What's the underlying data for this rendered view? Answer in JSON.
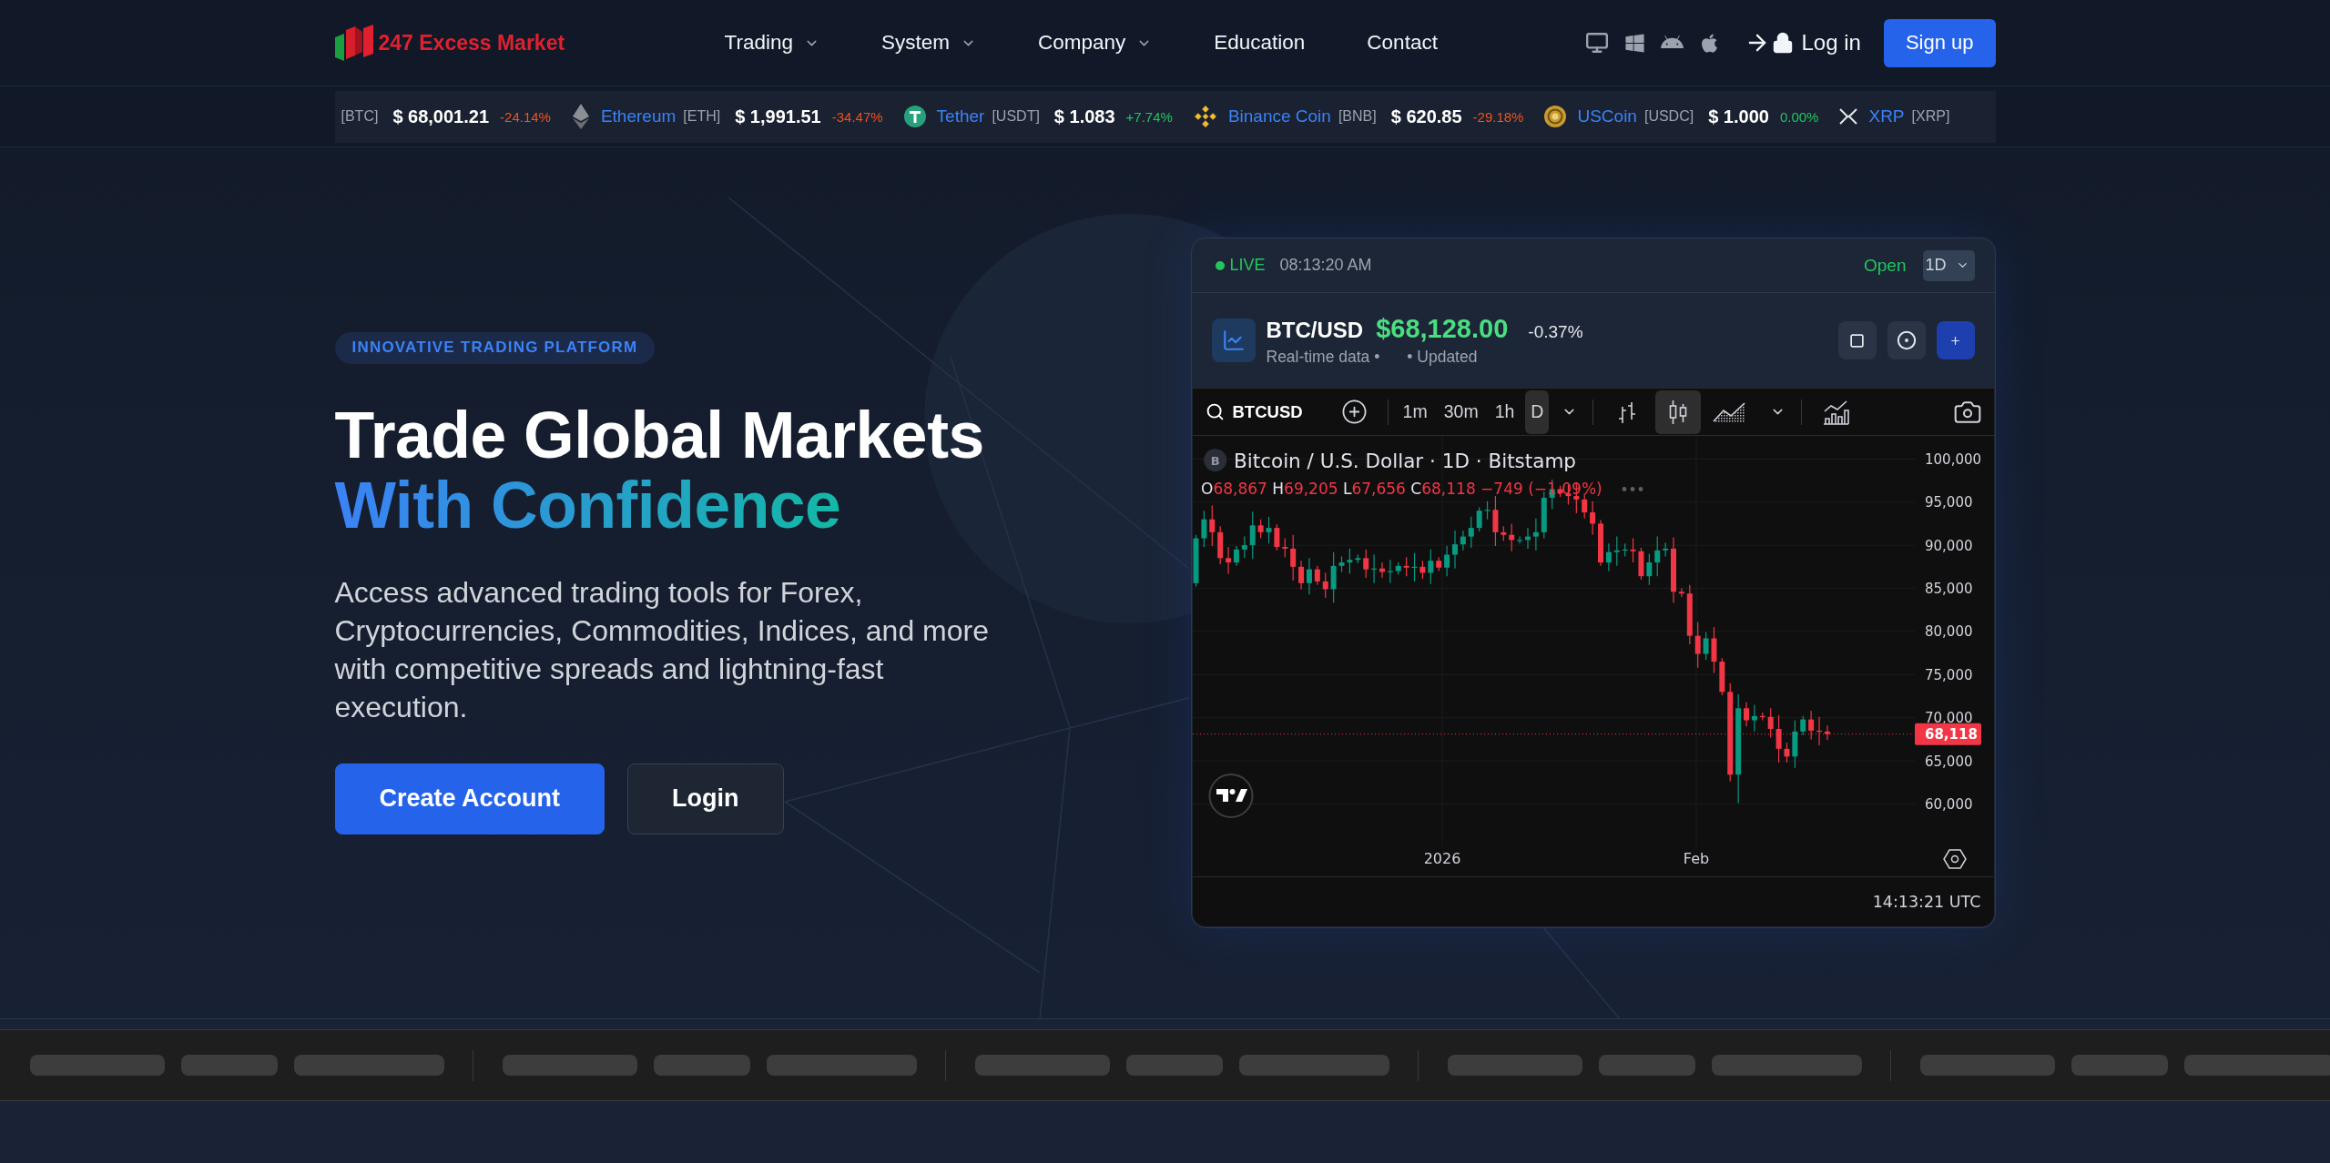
{
  "header": {
    "logo_text": "247 Excess Market",
    "nav": [
      {
        "label": "Trading",
        "dropdown": true
      },
      {
        "label": "System",
        "dropdown": true
      },
      {
        "label": "Company",
        "dropdown": true
      },
      {
        "label": "Education",
        "dropdown": false
      },
      {
        "label": "Contact",
        "dropdown": false
      }
    ],
    "login": "Log in",
    "signup": "Sign up"
  },
  "ticker": [
    {
      "symbol": "[BTC]",
      "price": "$ 68,001.21",
      "change": "-24.14%",
      "falling": true
    },
    {
      "name": "Ethereum",
      "symbol": "[ETH]",
      "price": "$ 1,991.51",
      "change": "-34.47%",
      "falling": true
    },
    {
      "name": "Tether",
      "symbol": "[USDT]",
      "price": "$ 1.083",
      "change": "+7.74%",
      "falling": false
    },
    {
      "name": "Binance Coin",
      "symbol": "[BNB]",
      "price": "$ 620.85",
      "change": "-29.18%",
      "falling": true
    },
    {
      "name": "USCoin",
      "symbol": "[USDC]",
      "price": "$ 1.000",
      "change": "0.00%",
      "falling": false
    },
    {
      "name": "XRP",
      "symbol": "[XRP]"
    }
  ],
  "hero": {
    "badge": "INNOVATIVE TRADING PLATFORM",
    "title": "Trade Global Markets",
    "title_accent": "With Confidence",
    "description": "Access advanced trading tools for Forex, Cryptocurrencies, Commodities, Indices, and more with competitive spreads and lightning-fast execution.",
    "buttons": [
      {
        "label": "Create Account",
        "kind": "primary"
      },
      {
        "label": "Login",
        "kind": "secondary"
      }
    ]
  },
  "widget": {
    "status": "LIVE",
    "time": "08:13:20 AM",
    "market_state": "Open",
    "interval_select": "1D",
    "symbol": "BTC/USD",
    "price": "$68,128.00",
    "change": "-0.37%",
    "subtitle": [
      "Real-time data •",
      "• Updated"
    ],
    "chart": {
      "search": "BTCUSD",
      "intervals": [
        {
          "label": "1m",
          "selected": false
        },
        {
          "label": "30m",
          "selected": false
        },
        {
          "label": "1h",
          "selected": false
        },
        {
          "label": "D",
          "selected": true
        }
      ],
      "styles": [
        {
          "kind": "bars",
          "selected": false
        },
        {
          "kind": "candles",
          "selected": true
        },
        {
          "kind": "area",
          "selected": false
        }
      ],
      "symbol_badge": "B",
      "title": "Bitcoin / U.S. Dollar · 1D · Bitstamp",
      "ohlc": [
        {
          "label": "O",
          "value": "68,867"
        },
        {
          "label": "H",
          "value": "69,205"
        },
        {
          "label": "L",
          "value": "67,656"
        },
        {
          "label": "C",
          "value": "68,118"
        }
      ],
      "change": "−749 (−1.09%)",
      "falling": true,
      "price_axis": [
        "100,000",
        "95,000",
        "90,000",
        "85,000",
        "80,000",
        "75,000",
        "70,000",
        "65,000",
        "60,000"
      ],
      "last_price": "68,118",
      "time_axis": [
        "2026",
        "Feb"
      ],
      "clock": "14:13:21 UTC"
    }
  }
}
